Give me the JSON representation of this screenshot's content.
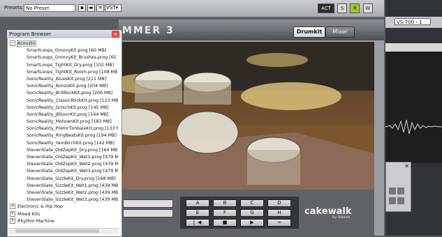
{
  "toolbar": {
    "presets_label": "Presets:",
    "preset_value": "No Preset",
    "vst_label": "VST",
    "right_buttons": [
      "ACT",
      "S",
      "R",
      "W"
    ]
  },
  "sonar": {
    "instrument_select": "VS-700 - 1"
  },
  "plugin": {
    "logo": "MMER 3",
    "tab_drumkit": "Drumkit",
    "tab_mixer": "Mixer",
    "pads": [
      "A",
      "B",
      "C",
      "D",
      "E",
      "F",
      "G",
      "H"
    ],
    "transport": [
      "rewind",
      "stop",
      "play",
      "loop"
    ],
    "brand": "cakewalk",
    "brand_sub": "by Roland"
  },
  "browser": {
    "title": "Program Browser",
    "close": "x",
    "root": "Acoustic",
    "items": [
      "SmartLoops_GroovyKit.prog [60 MB]",
      "SmartLoops_GroovyKit_Brushes.prog [65 M",
      "SmartLoops_TightKit_Dry.prog [102 MB]",
      "SmartLoops_TightKit_Room.prog [108 MB]",
      "SonicReality_BluesKit.prog [211 MB]",
      "SonicReality_BonzoKit.prog [204 MB]",
      "SonicReality_BritRockKit.prog [206 MB]",
      "SonicReality_ClassicRockKit.prog [123 MB]",
      "SonicReality_GrtschKit.prog [145 MB]",
      "SonicReality_JBSonrKit.prog [144 MB]",
      "SonicReality_MotownKit.prog [183 MB]",
      "SonicReality_PremrTimbaleKit.prog [133 MB",
      "SonicReality_RingBeatsKit.prog [194 MB]",
      "SonicReality_YamBirchKit.prog [142 MB]",
      "StevenSlate_OldZepKit_Dry.prog [164 MB]",
      "StevenSlate_OldZepKit_Wet1.prog [479 MB]",
      "StevenSlate_OldZepKit_Wet2.prog [479 MB]",
      "StevenSlate_OldZepKit_Wet3.prog [479 MB]",
      "StevenSlate_SizzleKit_Dry.prog [168 MB]",
      "StevenSlate_SizzleKit_Wet1.prog [439 MB]",
      "StevenSlate_SizzleKit_Wet2.prog [439 MB]",
      "StevenSlate_SizzleKit_Wet3.prog [439 MB]"
    ],
    "folders": [
      "Electronic & Hip Hop",
      "Mixed Kits",
      "Rhythm Machine"
    ]
  }
}
